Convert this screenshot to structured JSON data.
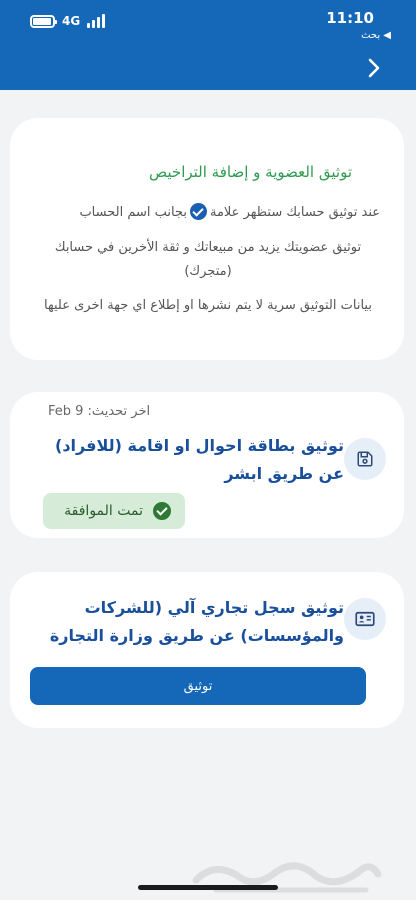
{
  "status_bar": {
    "network": "4G",
    "time": "11:10",
    "back_app": "◀ بحث"
  },
  "header": {
    "back_icon": "chevron-right-icon",
    "background_color": "#1567b8"
  },
  "membership_card": {
    "title": "توثيق العضوية و إضافة التراخيص",
    "line1_before": "عند توثيق حسابك ستظهر علامة",
    "line1_after": "بجانب اسم الحساب",
    "paragraph2": "توثيق عضويتك يزيد من مبيعاتك و ثقة الأخرين في حسابك (متجرك)",
    "paragraph3": "بيانات التوثيق سرية لا يتم نشرها او إطلاع اي جهة اخرى عليها"
  },
  "id_card_verification": {
    "updated_label": "اخر تحديث: Feb 9",
    "title": "توثيق بطاقة احوال او اقامة (للافراد) عن طريق ابشر",
    "icon": "save-icon",
    "status_label": "تمت الموافقة",
    "status_color": "#d6ecd8"
  },
  "commercial_verification": {
    "title": "توثيق سجل تجاري آلي (للشركات والمؤسسات) عن طريق وزارة التجارة",
    "icon": "id-card-icon",
    "button_label": "توثيق"
  },
  "watermark": {
    "text": "حراج"
  }
}
